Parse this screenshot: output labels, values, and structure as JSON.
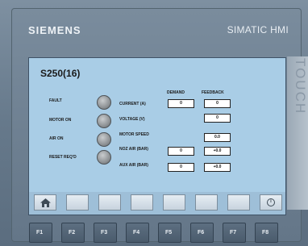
{
  "device": {
    "brand": "SIEMENS",
    "model": "SIMATIC HMI",
    "touch_label": "TOUCH"
  },
  "screen": {
    "title": "S250(16)",
    "columns": {
      "demand": "DEMAND",
      "feedback": "FEEDBACK"
    },
    "status_indicators": [
      {
        "label": "FAULT",
        "state": "off"
      },
      {
        "label": "MOTOR ON",
        "state": "off"
      },
      {
        "label": "AIR ON",
        "state": "off"
      },
      {
        "label": "RESET REQ'D",
        "state": "off"
      }
    ],
    "parameters": [
      {
        "label": "CURRENT (A)",
        "demand": "0",
        "feedback": "0"
      },
      {
        "label": "VOLTAGE (V)",
        "demand": null,
        "feedback": "0"
      },
      {
        "label": "MOTOR SPEED",
        "demand": null,
        "feedback": "0.0"
      },
      {
        "label": "NOZ AIR (BAR)",
        "demand": "0",
        "feedback": "+0.0"
      },
      {
        "label": "AUX AIR (BAR)",
        "demand": "0",
        "feedback": "+0.0"
      }
    ],
    "softkeys": [
      "home-icon",
      "",
      "",
      "",
      "",
      "",
      "",
      "info-icon"
    ]
  },
  "function_keys": [
    "F1",
    "F2",
    "F3",
    "F4",
    "F5",
    "F6",
    "F7",
    "F8"
  ],
  "colors": {
    "screen_bg": "#a9cde6",
    "bezel": "#6b7d8e",
    "field_bg": "#ffffff"
  }
}
